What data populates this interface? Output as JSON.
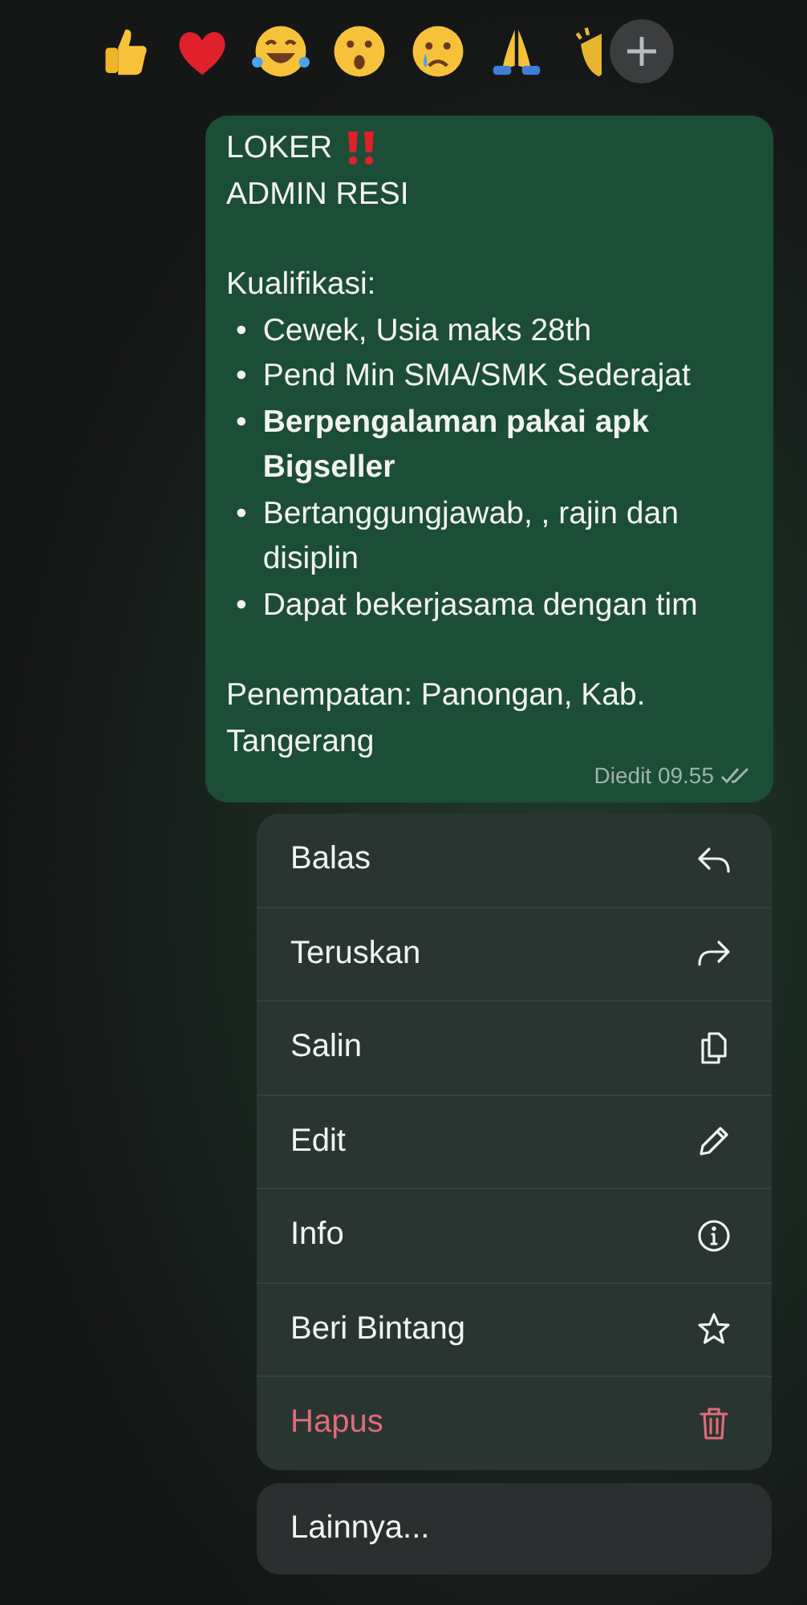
{
  "reactions": [
    {
      "kind": "thumbs_up"
    },
    {
      "kind": "heart"
    },
    {
      "kind": "laugh_tears"
    },
    {
      "kind": "surprised"
    },
    {
      "kind": "crying"
    },
    {
      "kind": "pray"
    },
    {
      "kind": "clap"
    }
  ],
  "message": {
    "lines": [
      "LOKER",
      "ADMIN RESI"
    ],
    "heading": "Kualifikasi:",
    "bullets": [
      {
        "marker": "•",
        "text": "Cewek, Usia maks 28th",
        "bold": false
      },
      {
        "marker": "•",
        "text": "Pend Min SMA/SMK Sederajat",
        "bold": false
      },
      {
        "marker": "•",
        "text": "Berpengalaman pakai apk Bigseller",
        "bold": true
      },
      {
        "marker": "•",
        "text": "Bertanggungjawab, , rajin dan disiplin",
        "bold": false
      },
      {
        "marker": "•",
        "text": "Dapat bekerjasama dengan tim",
        "bold": false
      }
    ],
    "footer": "Penempatan: Panongan, Kab. Tangerang",
    "meta": "Diedit 09.55"
  },
  "menu": [
    {
      "label": "Balas",
      "kind": "reply",
      "destructive": false
    },
    {
      "label": "Teruskan",
      "kind": "forward",
      "destructive": false
    },
    {
      "label": "Salin",
      "kind": "copy",
      "destructive": false
    },
    {
      "label": "Edit",
      "kind": "edit",
      "destructive": false
    },
    {
      "label": "Info",
      "kind": "info",
      "destructive": false
    },
    {
      "label": "Beri Bintang",
      "kind": "star",
      "destructive": false
    },
    {
      "label": "Hapus",
      "kind": "delete",
      "destructive": true
    }
  ],
  "more": "Lainnya..."
}
